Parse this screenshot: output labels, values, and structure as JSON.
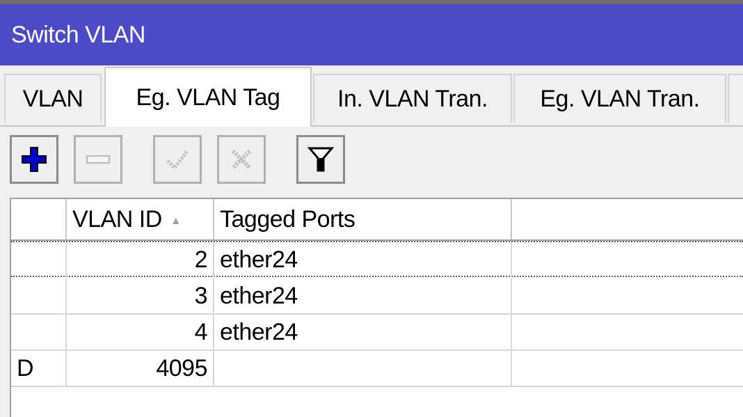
{
  "window": {
    "title": "Switch VLAN"
  },
  "tabs": [
    {
      "label": "VLAN",
      "active": false
    },
    {
      "label": "Eg. VLAN Tag",
      "active": true
    },
    {
      "label": "In. VLAN Tran.",
      "active": false
    },
    {
      "label": "Eg. VLAN Tran.",
      "active": false
    }
  ],
  "toolbar": {
    "buttons": [
      {
        "icon": "plus-icon",
        "enabled": true
      },
      {
        "icon": "minus-icon",
        "enabled": false
      },
      {
        "icon": "check-icon",
        "enabled": false
      },
      {
        "icon": "cross-icon",
        "enabled": false
      },
      {
        "icon": "filter-icon",
        "enabled": true
      }
    ]
  },
  "table": {
    "columns": [
      {
        "label": ""
      },
      {
        "label": "VLAN ID",
        "sort": "ascending"
      },
      {
        "label": "Tagged Ports"
      },
      {
        "label": ""
      }
    ],
    "rows": [
      {
        "flag": "",
        "vlan_id": "2",
        "tagged_ports": "ether24",
        "selected": true
      },
      {
        "flag": "",
        "vlan_id": "3",
        "tagged_ports": "ether24",
        "selected": false
      },
      {
        "flag": "",
        "vlan_id": "4",
        "tagged_ports": "ether24",
        "selected": false
      },
      {
        "flag": "D",
        "vlan_id": "4095",
        "tagged_ports": "",
        "selected": false
      }
    ]
  },
  "colors": {
    "titlebar": "#4b4bc8",
    "plus": "#0000cc"
  }
}
